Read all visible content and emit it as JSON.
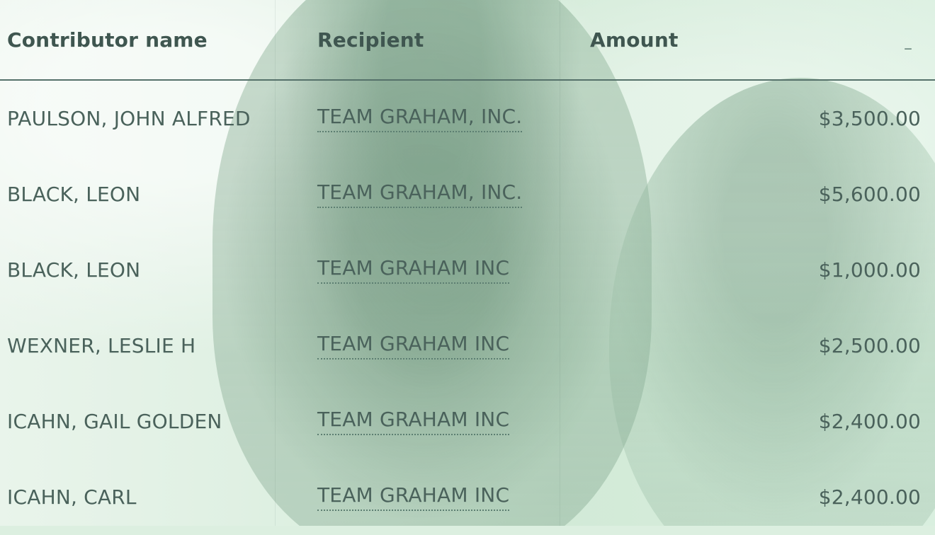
{
  "table": {
    "headers": {
      "contributor": "Contributor name",
      "recipient": "Recipient",
      "amount": "Amount",
      "action": "–"
    },
    "rows": [
      {
        "contributor": "PAULSON, JOHN ALFRED",
        "recipient": "TEAM GRAHAM, INC.",
        "amount": "$3,500.00"
      },
      {
        "contributor": "BLACK, LEON",
        "recipient": "TEAM GRAHAM, INC.",
        "amount": "$5,600.00"
      },
      {
        "contributor": "BLACK, LEON",
        "recipient": "TEAM GRAHAM INC",
        "amount": "$1,000.00"
      },
      {
        "contributor": "WEXNER, LESLIE H",
        "recipient": "TEAM GRAHAM INC",
        "amount": "$2,500.00"
      },
      {
        "contributor": "ICAHN, GAIL GOLDEN",
        "recipient": "TEAM GRAHAM INC",
        "amount": "$2,400.00"
      },
      {
        "contributor": "ICAHN, CARL",
        "recipient": "TEAM GRAHAM INC",
        "amount": "$2,400.00"
      }
    ]
  },
  "theme": {
    "text_color": "#3f5650",
    "rule_color": "#55716a",
    "bg_tint": "#dcefe0"
  }
}
